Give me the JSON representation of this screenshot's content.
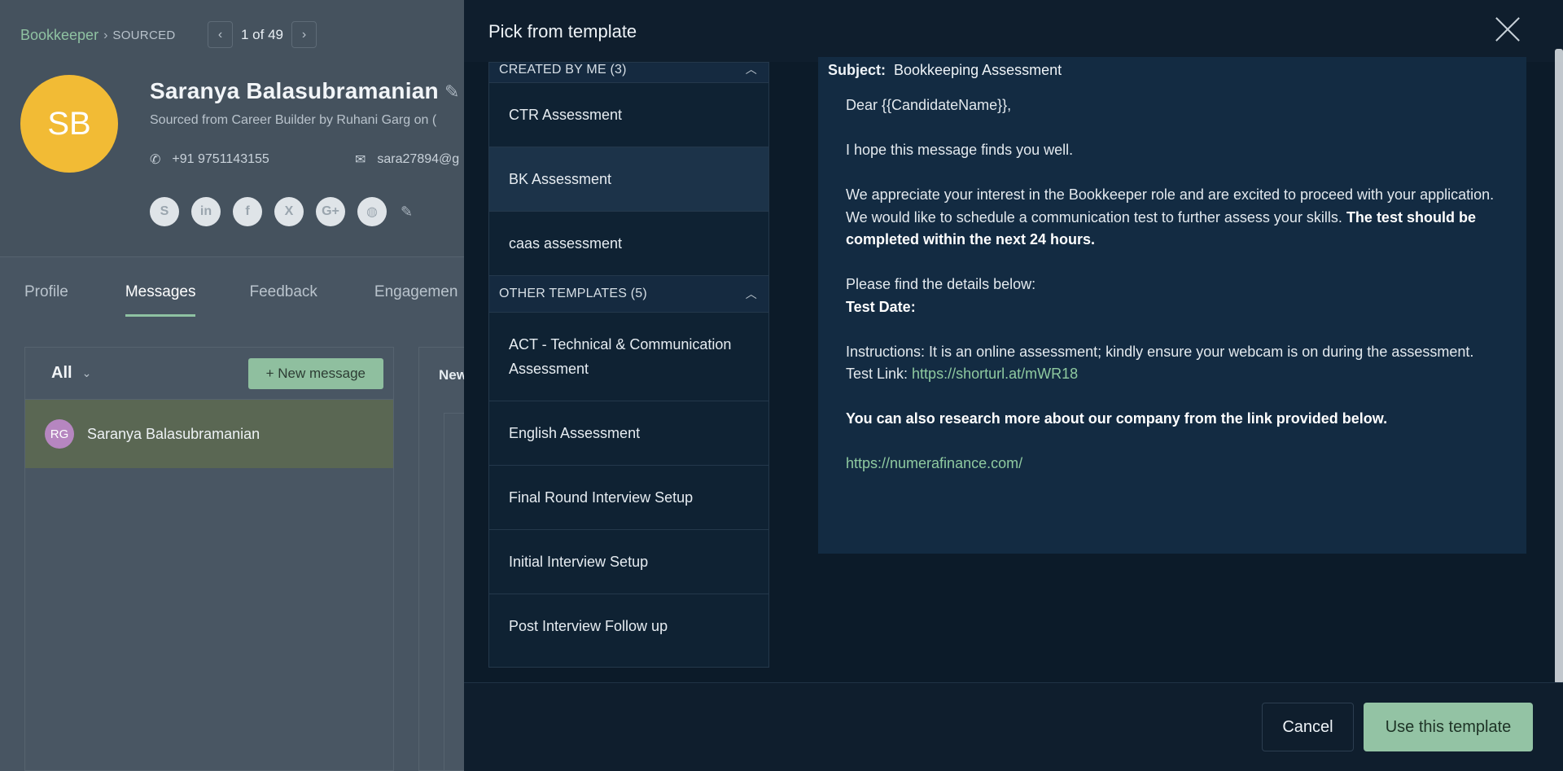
{
  "background": {
    "breadcrumb": {
      "job": "Bookkeeper",
      "stage": "SOURCED"
    },
    "pager": {
      "count": "1 of 49"
    },
    "candidate": {
      "initials": "SB",
      "name": "Saranya Balasubramanian",
      "sourced": "Sourced from Career Builder by Ruhani Garg on (",
      "phone": "+91 9751143155",
      "email": "sara27894@g"
    },
    "socials": [
      "skype-icon",
      "linkedin-icon",
      "facebook-icon",
      "x-icon",
      "google-plus-icon",
      "globe-icon"
    ],
    "tabs": [
      "Profile",
      "Messages",
      "Feedback",
      "Engagemen"
    ],
    "messages": {
      "filter": "All",
      "new_message": "+ New message",
      "thread": {
        "initials": "RG",
        "name": "Saranya Balasubramanian"
      },
      "conversation_label": "New"
    }
  },
  "modal": {
    "title": "Pick from template",
    "groups": [
      {
        "label": "CREATED BY ME (3)",
        "items": [
          "CTR Assessment",
          "BK Assessment",
          "caas assessment"
        ]
      },
      {
        "label": "OTHER TEMPLATES (5)",
        "items": [
          "ACT - Technical & Communication Assessment",
          "English Assessment",
          "Final Round Interview Setup",
          "Initial Interview Setup",
          "Post Interview Follow up"
        ]
      }
    ],
    "selected": "BK Assessment",
    "preview": {
      "subject_label": "Subject:",
      "subject": "Bookkeeping Assessment",
      "greeting": "Dear {{CandidateName}},",
      "line1": "I hope this message finds you well.",
      "line2": "We appreciate your interest in the Bookkeeper role and are excited to proceed with your application.",
      "line3_plain": "We would like to schedule a communication test to further assess your skills. ",
      "line3_bold": "The test should be completed within the next 24 hours.",
      "line4": "Please find the details below:",
      "test_date_label": "Test Date:",
      "instructions": "Instructions: It is an online assessment; kindly ensure your webcam is on during the assessment.",
      "test_link_label": "Test Link: ",
      "test_link": "https://shorturl.at/mWR18",
      "research": "You can also research more about our company from the link provided below.",
      "company_link": "https://numerafinance.com/"
    },
    "cancel_label": "Cancel",
    "use_label": "Use this template"
  },
  "colors": {
    "accent": "#8fc2a2",
    "modal_bg": "#0f1e2d",
    "selected_item": "#1c3349",
    "avatar": "#f2bb35"
  }
}
